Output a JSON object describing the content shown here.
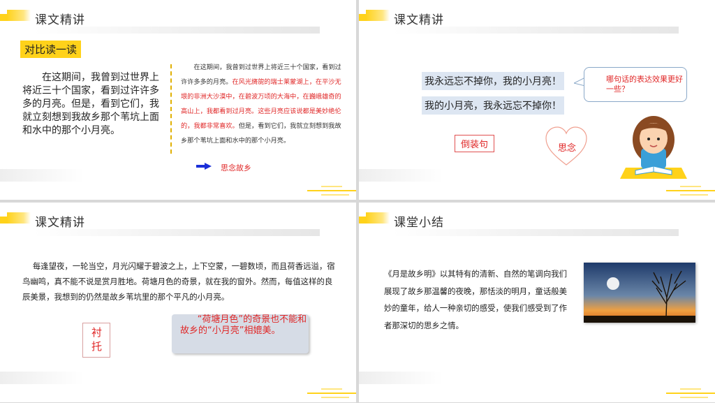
{
  "slide1": {
    "header": "课文精讲",
    "tag": "对比读一读",
    "left_text": "在这期间，我曾到过世界上将近三十个国家，看到过许许多多的月亮。但是，看到它们，我就立刻想到我故乡那个苇坑上面和水中的那个小月亮。",
    "right_text_a": "在这期间，我曾到过世界上将近三十个国家，看到过许许多多的月亮。",
    "right_text_red": "在风光旖旎的瑞士莱蒙湖上，在平沙无垠的非洲大沙漠中，在碧波万顷的大海中，在巍峨雄奇的高山上，我都看到过月亮。这些月亮应该说都是美妙绝伦的，我都非常喜欢。",
    "right_text_b": "但是，看到它们，我就立刻想到我故乡那个苇坑上面和水中的那个小月亮。",
    "arrow_text": "思念故乡"
  },
  "slide2": {
    "header": "课文精讲",
    "sentence1": "我永远忘不掉你，我的小月亮！",
    "sentence2": "我的小月亮，我永远忘不掉你！",
    "bubble": "哪句话的表达效果更好一些？",
    "tag": "倒装句",
    "heart": "思念"
  },
  "slide3": {
    "header": "课文精讲",
    "paragraph": "每逢望夜，一轮当空，月光闪耀于碧波之上，上下空蒙，一碧数顷，而且荷香远溢，宿鸟幽鸣，真不能不说是赏月胜地。荷塘月色的奇景，就在我的窗外。然而，每值这样的良辰美景，我想到的仍然是故乡苇坑里的那个平凡的小月亮。",
    "vertical_tag": "衬托",
    "scroll_text": "“荷塘月色”的奇景也不能和故乡的“小月亮”相媲美。"
  },
  "slide4": {
    "header": "课堂小结",
    "summary": "《月是故乡明》以其特有的清新、自然的笔调向我们展现了故乡那温馨的夜晚，那恬淡的明月，童话般美妙的童年，给人一种亲切的感受，使我们感受到了作者那深切的思乡之情。"
  },
  "colors": {
    "accent": "#ffd21a",
    "red": "#e02828",
    "arrow": "#1a2fd8",
    "highlight": "#dde6f2"
  }
}
